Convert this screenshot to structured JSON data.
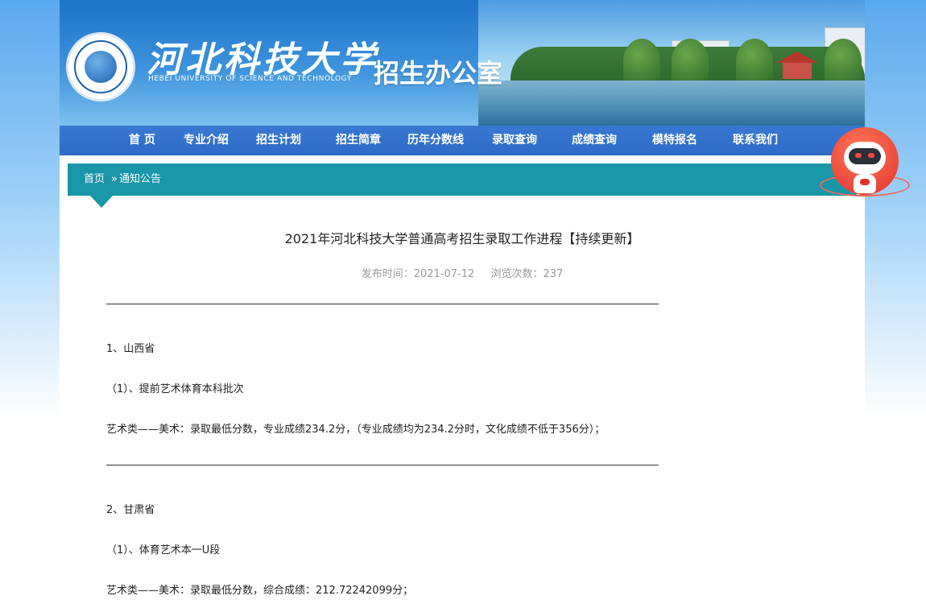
{
  "header": {
    "university_name": "河北科技大学",
    "university_name_en": "HEBEI UNIVERSITY OF SCIENCE AND TECHNOLOGY",
    "office_title": "招生办公室"
  },
  "nav": {
    "items": [
      {
        "label": "首 页"
      },
      {
        "label": "专业介绍"
      },
      {
        "label": "招生计划"
      },
      {
        "label": "招生简章"
      },
      {
        "label": "历年分数线"
      },
      {
        "label": "录取查询"
      },
      {
        "label": "成绩查询"
      },
      {
        "label": "模特报名"
      },
      {
        "label": "联系我们"
      }
    ]
  },
  "breadcrumb": {
    "home": "首页",
    "separator": "»",
    "current": "通知公告"
  },
  "article": {
    "title": "2021年河北科技大学普通高考招生录取工作进程【持续更新】",
    "published": "发布时间：2021-07-12",
    "views": "浏览次数：237",
    "lines": [
      "1、山西省",
      "（1）、提前艺术体育本科批次",
      "艺术类——美术：录取最低分数，专业成绩234.2分，（专业成绩均为234.2分时，文化成绩不低于356分）；",
      "2、甘肃省",
      "（1）、体育艺术本一U段",
      "艺术类——美术：录取最低分数，综合成绩：212.72242099分；"
    ]
  },
  "colors": {
    "nav_bg": "#2d6bc6",
    "breadcrumb_bg": "#1996a8",
    "robot": "#e0302a"
  },
  "icons": {
    "logo": "university-seal",
    "assistant": "robot-assistant-icon"
  }
}
